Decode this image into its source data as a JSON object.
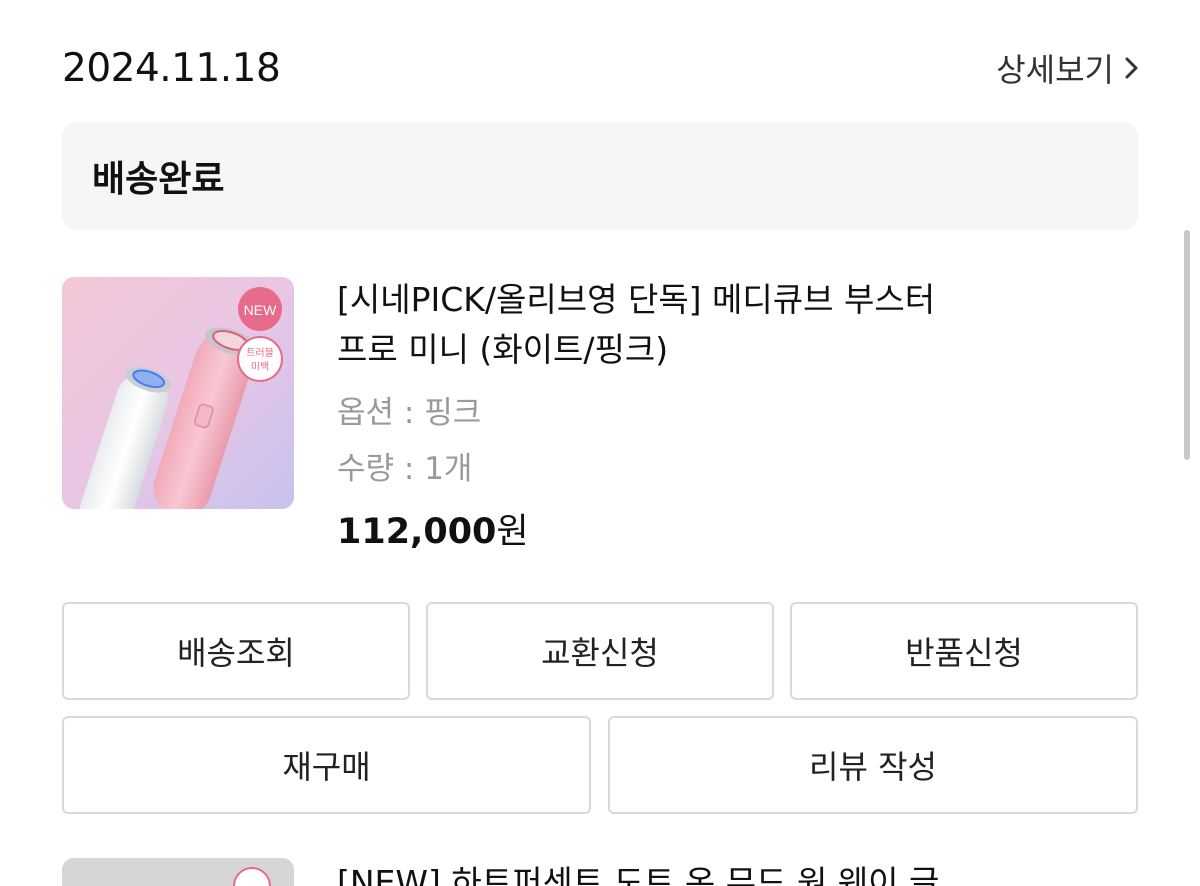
{
  "order": {
    "date": "2024.11.18",
    "detail_label": "상세보기",
    "status": "배송완료"
  },
  "product": {
    "name_line1": "[시네PICK/올리브영 단독] 메디큐브 부스터",
    "name_line2": "프로 미니 (화이트/핑크)",
    "option": "옵션 : 핑크",
    "quantity": "수량 : 1개",
    "price_amount": "112,000",
    "price_unit": "원",
    "thumb_badge_new": "NEW",
    "thumb_badge_line1": "트러블",
    "thumb_badge_line2": "미백"
  },
  "actions": {
    "track": "배송조회",
    "exchange": "교환신청",
    "return": "반품신청",
    "reorder": "재구매",
    "review": "리뷰 작성"
  },
  "next_product": {
    "name": "[NEW] 하트퍼센트 도트 온 무드 원 웨이 글"
  },
  "colors": {
    "status_bg": "#f5f6f8",
    "button_border": "#d9d9d9",
    "muted_text": "#9a9a9a",
    "badge_new": "#e86a8a"
  }
}
